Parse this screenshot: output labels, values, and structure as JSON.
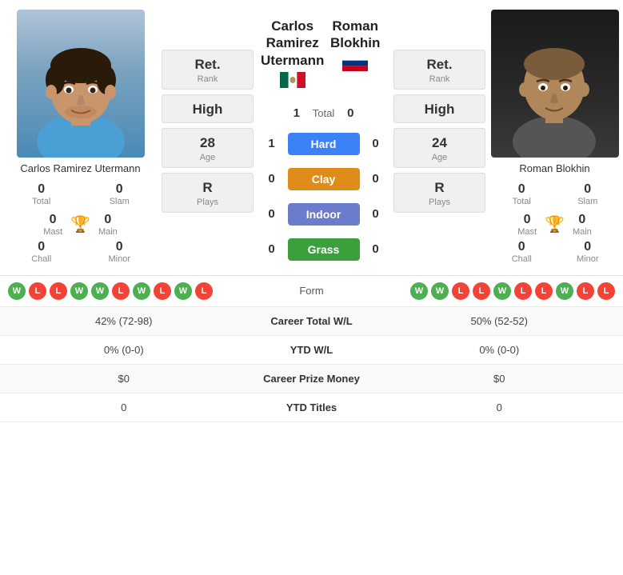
{
  "players": {
    "left": {
      "name": "Carlos Ramirez Utermann",
      "name_line1": "Carlos Ramirez",
      "name_line2": "Utermann",
      "flag": "mx",
      "stats": {
        "total": "0",
        "slam": "0",
        "mast": "0",
        "main": "0",
        "chall": "0",
        "minor": "0"
      },
      "rank_label": "Ret.",
      "rank_sub": "Rank",
      "high_label": "High",
      "age_value": "28",
      "age_label": "Age",
      "plays_value": "R",
      "plays_label": "Plays",
      "form": [
        "W",
        "L",
        "L",
        "W",
        "W",
        "L",
        "W",
        "L",
        "W",
        "L"
      ]
    },
    "right": {
      "name": "Roman Blokhin",
      "flag": "ru",
      "stats": {
        "total": "0",
        "slam": "0",
        "mast": "0",
        "main": "0",
        "chall": "0",
        "minor": "0"
      },
      "rank_label": "Ret.",
      "rank_sub": "Rank",
      "high_label": "High",
      "age_value": "24",
      "age_label": "Age",
      "plays_value": "R",
      "plays_label": "Plays",
      "form": [
        "W",
        "W",
        "L",
        "L",
        "W",
        "L",
        "L",
        "W",
        "L",
        "L"
      ]
    }
  },
  "scores": {
    "total_left": "1",
    "total_right": "0",
    "total_label": "Total",
    "hard_left": "1",
    "hard_right": "0",
    "hard_label": "Hard",
    "clay_left": "0",
    "clay_right": "0",
    "clay_label": "Clay",
    "indoor_left": "0",
    "indoor_right": "0",
    "indoor_label": "Indoor",
    "grass_left": "0",
    "grass_right": "0",
    "grass_label": "Grass"
  },
  "bottom_rows": [
    {
      "left": "42% (72-98)",
      "center": "Career Total W/L",
      "right": "50% (52-52)"
    },
    {
      "left": "0% (0-0)",
      "center": "YTD W/L",
      "right": "0% (0-0)"
    },
    {
      "left": "$0",
      "center": "Career Prize Money",
      "right": "$0"
    },
    {
      "left": "0",
      "center": "YTD Titles",
      "right": "0"
    }
  ],
  "form_label": "Form"
}
